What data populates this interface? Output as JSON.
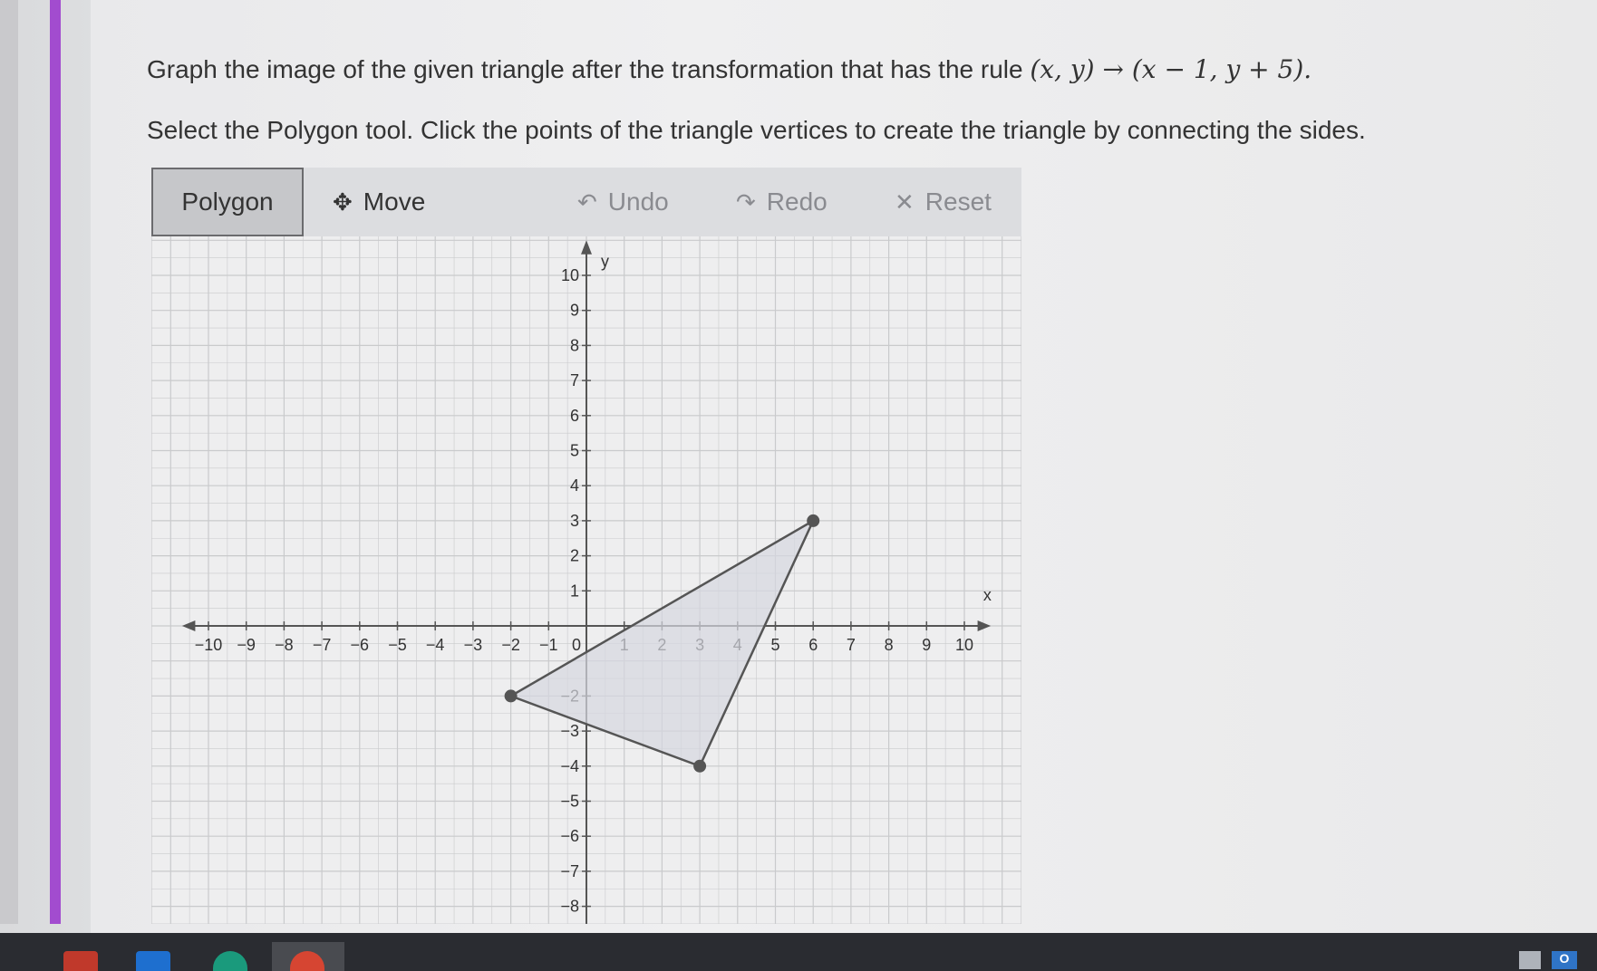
{
  "colors": {
    "accent": "#a24ccf",
    "triangle_fill": "#d5d7df",
    "triangle_stroke": "#555",
    "grid": "#c9cacc",
    "axis": "#555"
  },
  "prompt": {
    "line1_text": "Graph the image of the given triangle after the transformation that has the rule ",
    "line1_rule": "(x, y) → (x − 1, y + 5).",
    "line2": "Select the Polygon tool. Click the points of the triangle vertices to create the triangle by connecting the sides."
  },
  "toolbar": {
    "polygon": "Polygon",
    "move": "Move",
    "undo": "Undo",
    "redo": "Redo",
    "reset": "Reset",
    "icons": {
      "move": "move-arrows-icon",
      "undo": "undo-arrow-icon",
      "redo": "redo-arrow-icon",
      "reset": "close-x-icon"
    }
  },
  "graph": {
    "x_axis_label": "x",
    "y_axis_label": "y",
    "xlim": [
      -10,
      10
    ],
    "ylim": [
      -8,
      10
    ],
    "x_tick_labels": [
      "−10",
      "−9",
      "−8",
      "−7",
      "−6",
      "−5",
      "−4",
      "−3",
      "−2",
      "−1",
      "1",
      "2",
      "3",
      "4",
      "5",
      "6",
      "7",
      "8",
      "9",
      "10"
    ],
    "y_tick_labels": [
      "10",
      "9",
      "8",
      "7",
      "6",
      "5",
      "4",
      "3",
      "2",
      "1",
      "−2",
      "−3",
      "−4",
      "−5",
      "−6",
      "−7",
      "−8"
    ],
    "origin_label": "0",
    "grid": true,
    "triangle": [
      {
        "x": 6,
        "y": 3
      },
      {
        "x": -2,
        "y": -2
      },
      {
        "x": 3,
        "y": -4
      }
    ]
  },
  "taskbar": {
    "apps": [
      "app-icon",
      "mail-icon",
      "edge-browser-icon",
      "chrome-browser-icon"
    ],
    "tray_label": "O"
  }
}
